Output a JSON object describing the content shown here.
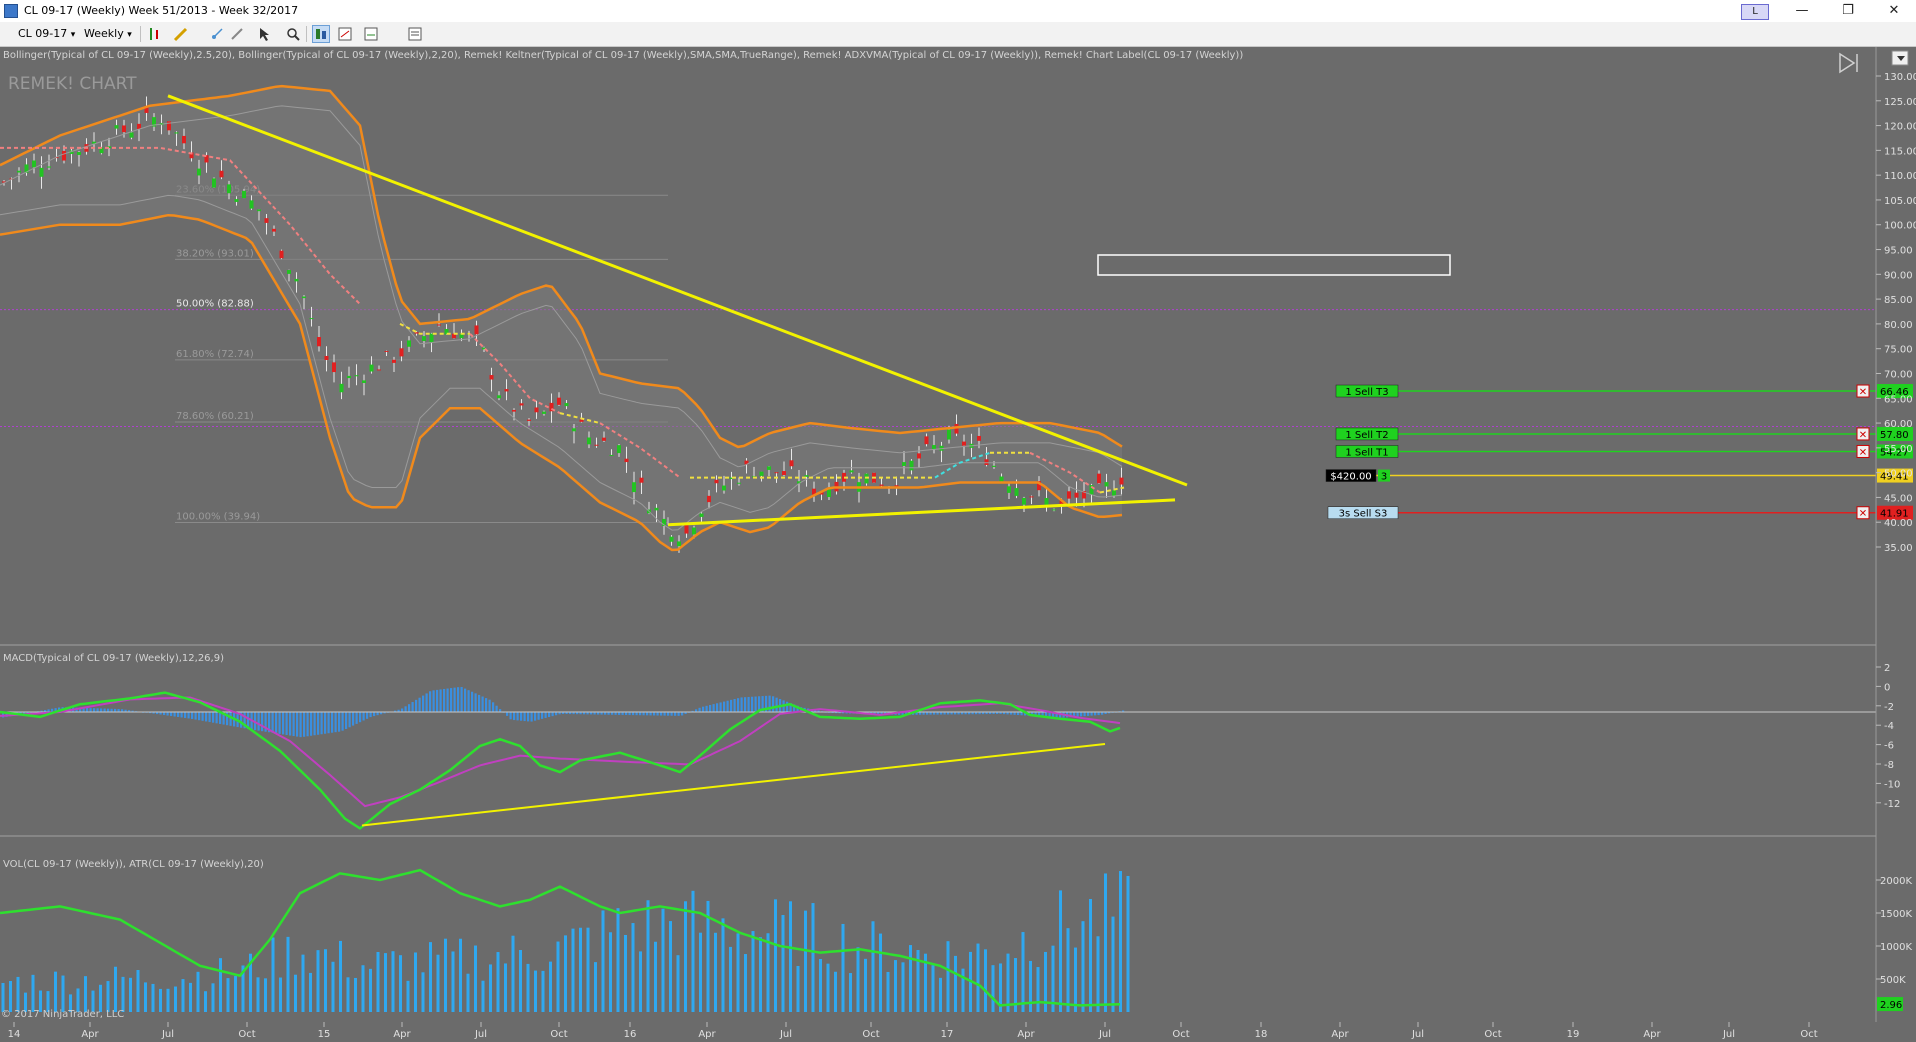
{
  "window": {
    "title": "CL 09-17 (Weekly)  Week 51/2013 - Week 32/2017",
    "buttons": {
      "link": "L",
      "minimize": "—",
      "restore": "❐",
      "close": "✕"
    }
  },
  "toolbar": {
    "instrument": "CL 09-17",
    "period": "Weekly",
    "dropdown_glyph": "▾"
  },
  "panels": {
    "price": {
      "indicator_label": "Bollinger(Typical of CL 09-17 (Weekly),2.5,20), Bollinger(Typical of CL 09-17 (Weekly),2,20), Remek! Keltner(Typical of CL 09-17 (Weekly),SMA,SMA,TrueRange), Remek! ADXVMA(Typical of CL 09-17 (Weekly)), Remek! Chart Label(CL 09-17 (Weekly))",
      "watermark": "REMEK! CHART",
      "axis_ticks": [
        "130.00",
        "125.00",
        "120.00",
        "115.00",
        "110.00",
        "105.00",
        "100.00",
        "95.00",
        "90.00",
        "85.00",
        "80.00",
        "75.00",
        "70.00",
        "65.00",
        "60.00",
        "55.00",
        "50.00",
        "45.00",
        "40.00",
        "35.00"
      ],
      "fib_levels": [
        {
          "label": "23.60% (105.94)"
        },
        {
          "label": "38.20% (93.01)"
        },
        {
          "label": "50.00% (82.88)"
        },
        {
          "label": "61.80% (72.74)"
        },
        {
          "label": "78.60% (60.21)"
        },
        {
          "label": "100.00% (39.94)"
        }
      ],
      "orders": [
        {
          "tag": "1  Sell T3",
          "price": "66.46"
        },
        {
          "tag": "1  Sell T2",
          "price": "57.80"
        },
        {
          "tag": "1  Sell T1",
          "price": "54.27"
        },
        {
          "tag": "$420.00",
          "qty": "3",
          "price": "49.41"
        },
        {
          "tag": "3s  Sell S3",
          "price": "41.91"
        }
      ],
      "close_glyph": "✕"
    },
    "macd": {
      "indicator_label": "MACD(Typical of CL 09-17 (Weekly),12,26,9)",
      "axis_ticks": [
        "2",
        "0",
        "-2",
        "-4",
        "-6",
        "-8",
        "-10",
        "-12"
      ]
    },
    "volume": {
      "indicator_label": "VOL(CL 09-17 (Weekly)), ATR(CL 09-17 (Weekly),20)",
      "axis_ticks": [
        "2000K",
        "1500K",
        "1000K",
        "500K"
      ],
      "atr_value": "2.96"
    }
  },
  "x_axis": {
    "labels": [
      "14",
      "Apr",
      "Jul",
      "Oct",
      "15",
      "Apr",
      "Jul",
      "Oct",
      "16",
      "Apr",
      "Jul",
      "Oct",
      "17",
      "Apr",
      "Jul",
      "Oct",
      "18",
      "Apr",
      "Jul",
      "Oct",
      "19",
      "Apr",
      "Jul",
      "Oct"
    ]
  },
  "copyright": "© 2017 NinjaTrader, LLC",
  "colors": {
    "background": "#6b6b6b",
    "trendline": "#f2f200",
    "bollinger_outer": "#f08a1c",
    "macd_line": "#2ee02e",
    "signal_line": "#c040c0",
    "histogram": "#3a8fe0",
    "volume": "#2fa8f0",
    "fib_purple": "#b040d0",
    "sell_green": "#1fd11f",
    "stop_red": "#e02020",
    "position_yellow": "#f0d020"
  }
}
